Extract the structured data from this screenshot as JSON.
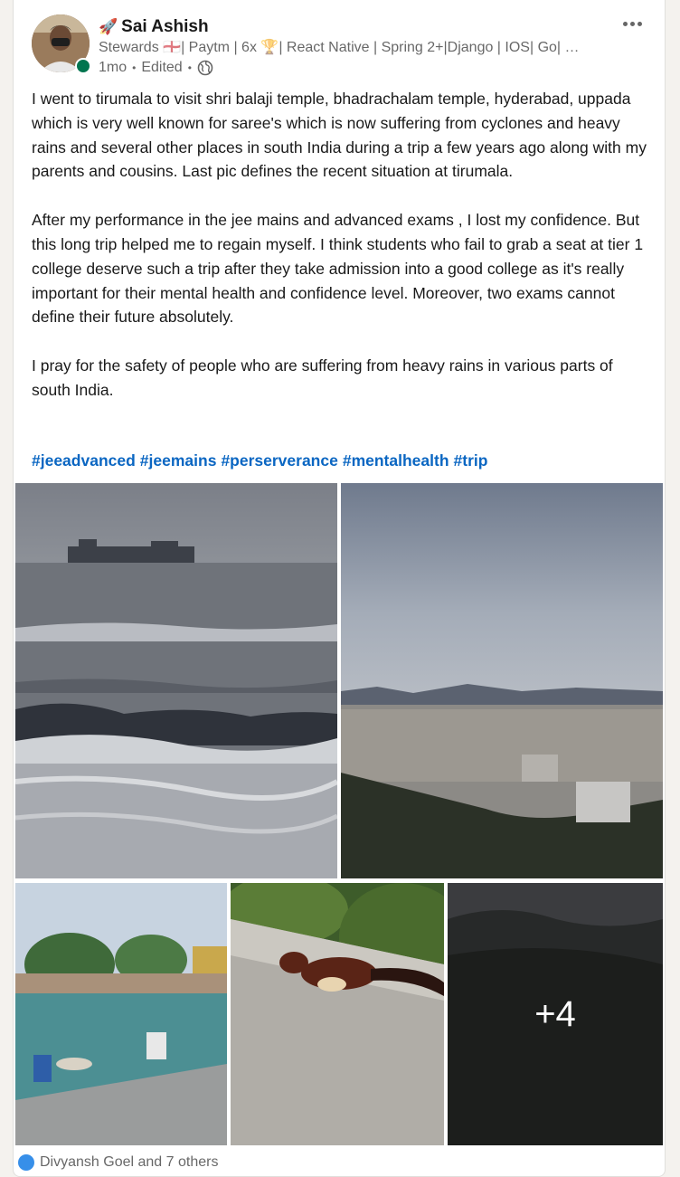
{
  "author": {
    "name": "Sai Ashish",
    "name_emoji": "🚀",
    "headline": "Stewards 🏴󠁧󠁢󠁥󠁮󠁧󠁿| Paytm | 6x 🏆| React Native | Spring 2+|Django | IOS| Go| …",
    "time": "1mo",
    "edited": "Edited",
    "visibility_icon": "globe-icon",
    "online": true
  },
  "post": {
    "paragraphs": [
      "I went to tirumala to visit shri balaji temple, bhadrachalam temple, hyderabad, uppada which is very well known for saree's which is now suffering from cyclones and heavy rains and several other places in south India during a trip a few years ago along with my parents and cousins. Last pic defines the recent situation at tirumala.",
      "After my performance in the jee mains and advanced exams , I lost my confidence. But this long trip helped me to regain myself. I think students who fail to grab a seat at tier 1 college deserve such a trip after they take admission into a good college as it's really important for their mental health and confidence level. Moreover, two exams cannot define their future absolutely.",
      "I pray for the safety of people who are suffering from heavy rains in various parts of south India."
    ],
    "hashtags": [
      "#jeeadvanced",
      "#jeemains",
      "#perserverance",
      "#mentalhealth",
      "#trip"
    ]
  },
  "photos": {
    "more_count": "+4"
  },
  "reactions": {
    "text": "Divyansh Goel and 7 others"
  },
  "colors": {
    "accent": "#0a66c2",
    "online": "#01754f"
  }
}
